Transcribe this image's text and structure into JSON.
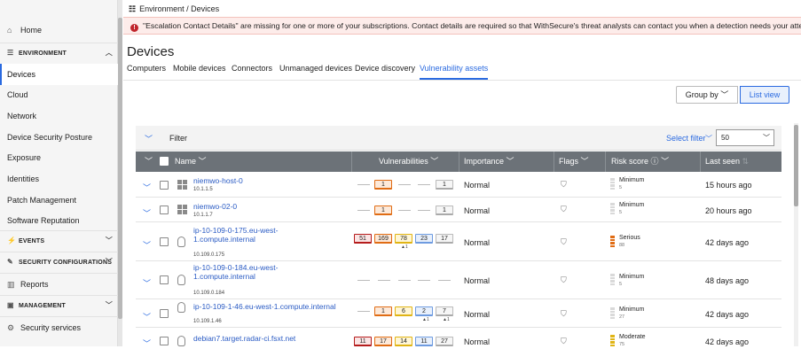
{
  "sidebar": {
    "home": "Home",
    "environment_section": "ENVIRONMENT",
    "items": [
      "Devices",
      "Cloud",
      "Network",
      "Device Security Posture",
      "Exposure",
      "Identities",
      "Patch Management",
      "Software Reputation"
    ],
    "events_section": "EVENTS",
    "security_config_section": "SECURITY CONFIGURATIONS",
    "reports": "Reports",
    "management_section": "MANAGEMENT",
    "security_services": "Security services"
  },
  "header": {
    "breadcrumb": "Environment / Devices",
    "alert": "\"Escalation Contact Details\" are missing for one or more of your subscriptions. Contact details are required so that WithSecure's threat analysts can contact you when a detection needs your attention.",
    "title": "Devices",
    "tabs": [
      "Computers",
      "Mobile devices",
      "Connectors",
      "Unmanaged devices",
      "Device discovery",
      "Vulnerability assets"
    ],
    "active_tab": "Vulnerability assets"
  },
  "toolbar": {
    "group_by": "Group by",
    "list_view": "List view",
    "filter": "Filter",
    "select_filter": "Select filter",
    "per_page": "50"
  },
  "table": {
    "columns": {
      "name": "Name",
      "vulnerabilities": "Vulnerabilities",
      "importance": "Importance",
      "flags": "Flags",
      "risk_score": "Risk score",
      "last_seen": "Last seen"
    },
    "rows": [
      {
        "name": "niemwo-host-0",
        "ip": "10.1.1.5",
        "os": "windows",
        "vulns": [
          "",
          "1",
          "",
          "",
          "1"
        ],
        "subs": [
          "",
          "",
          "",
          "",
          ""
        ],
        "importance": "Normal",
        "risk": "Minimum",
        "risk_value": "5",
        "last_seen": "15 hours ago"
      },
      {
        "name": "niemwo-02-0",
        "ip": "10.1.1.7",
        "os": "windows",
        "vulns": [
          "",
          "1",
          "",
          "",
          "1"
        ],
        "subs": [
          "",
          "",
          "",
          "",
          ""
        ],
        "importance": "Normal",
        "risk": "Minimum",
        "risk_value": "5",
        "last_seen": "20 hours ago"
      },
      {
        "name": "ip-10-109-0-175.eu-west-1.compute.internal",
        "name_l1": "ip-10-109-0-175.eu-west-",
        "name_l2": "1.compute.internal",
        "ip": "10.109.0.175",
        "os": "linux",
        "vulns": [
          "51",
          "169",
          "78",
          "23",
          "17"
        ],
        "subs": [
          "",
          "",
          "▲1",
          "",
          ""
        ],
        "importance": "Normal",
        "risk": "Serious",
        "risk_value": "88",
        "last_seen": "42 days ago"
      },
      {
        "name": "ip-10-109-0-184.eu-west-1.compute.internal",
        "name_l1": "ip-10-109-0-184.eu-west-",
        "name_l2": "1.compute.internal",
        "ip": "10.109.0.184",
        "os": "linux",
        "vulns": [
          "",
          "",
          "",
          "",
          ""
        ],
        "subs": [
          "",
          "",
          "",
          "",
          ""
        ],
        "importance": "Normal",
        "risk": "Minimum",
        "risk_value": "5",
        "last_seen": "48 days ago"
      },
      {
        "name": "ip-10-109-1-46.eu-west-1.compute.internal",
        "ip": "10.109.1.46",
        "os": "linux",
        "vulns": [
          "",
          "1",
          "6",
          "2",
          "7"
        ],
        "subs": [
          "",
          "",
          "",
          "▲1",
          "▲1"
        ],
        "importance": "Normal",
        "risk": "Minimum",
        "risk_value": "27",
        "last_seen": "42 days ago"
      },
      {
        "name": "debian7.target.radar-ci.fsxt.net",
        "ip": "",
        "os": "linux",
        "vulns": [
          "11",
          "17",
          "14",
          "11",
          "27"
        ],
        "subs": [
          "",
          "",
          "",
          "",
          ""
        ],
        "importance": "Normal",
        "risk": "Moderate",
        "risk_value": "75",
        "last_seen": "42 days ago"
      }
    ]
  },
  "colors": {
    "accent": "#2a6ae0",
    "critical": "#b51c1c",
    "high": "#e06c14",
    "medium": "#e0b414",
    "low": "#6e9be0",
    "alert_bg": "#fdecea",
    "header_bg": "#6c7278"
  }
}
